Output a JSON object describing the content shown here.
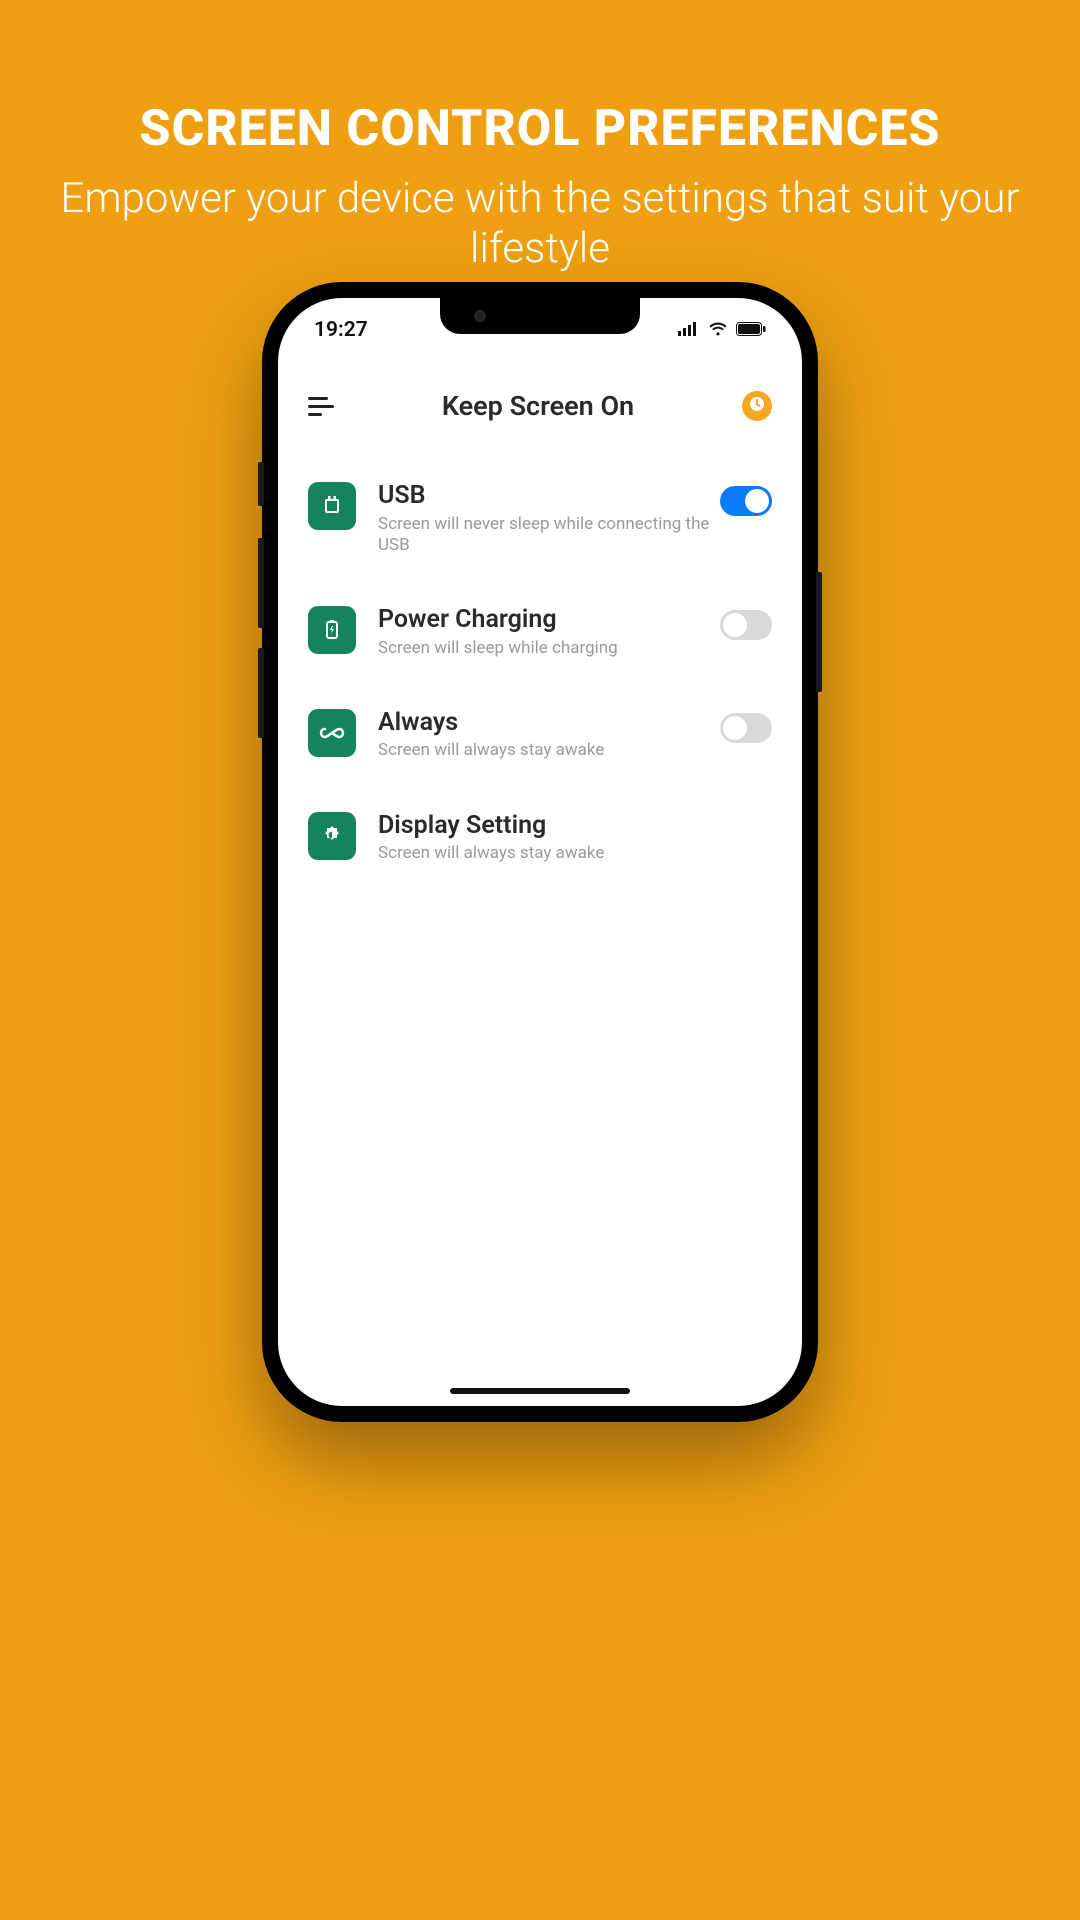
{
  "promo": {
    "title": "SCREEN CONTROL PREFERENCES",
    "subtitle": "Empower your device with the settings that suit your lifestyle"
  },
  "status": {
    "time": "19:27"
  },
  "app": {
    "title": "Keep Screen On"
  },
  "settings": [
    {
      "icon": "usb-icon",
      "title": "USB",
      "desc": "Screen will never sleep while connecting the USB",
      "toggle": "on",
      "has_toggle": true
    },
    {
      "icon": "battery-charging-icon",
      "title": "Power Charging",
      "desc": "Screen will sleep while charging",
      "toggle": "off",
      "has_toggle": true
    },
    {
      "icon": "infinity-icon",
      "title": "Always",
      "desc": "Screen will always stay awake",
      "toggle": "off",
      "has_toggle": true
    },
    {
      "icon": "brightness-icon",
      "title": "Display Setting",
      "desc": "Screen will always stay awake",
      "toggle": null,
      "has_toggle": false
    }
  ],
  "colors": {
    "page_bg": "#eea012",
    "icon_bg": "#158360",
    "toggle_on": "#0a7aff",
    "toggle_off": "#d9d9d9",
    "clock_badge": "#f5a623"
  }
}
